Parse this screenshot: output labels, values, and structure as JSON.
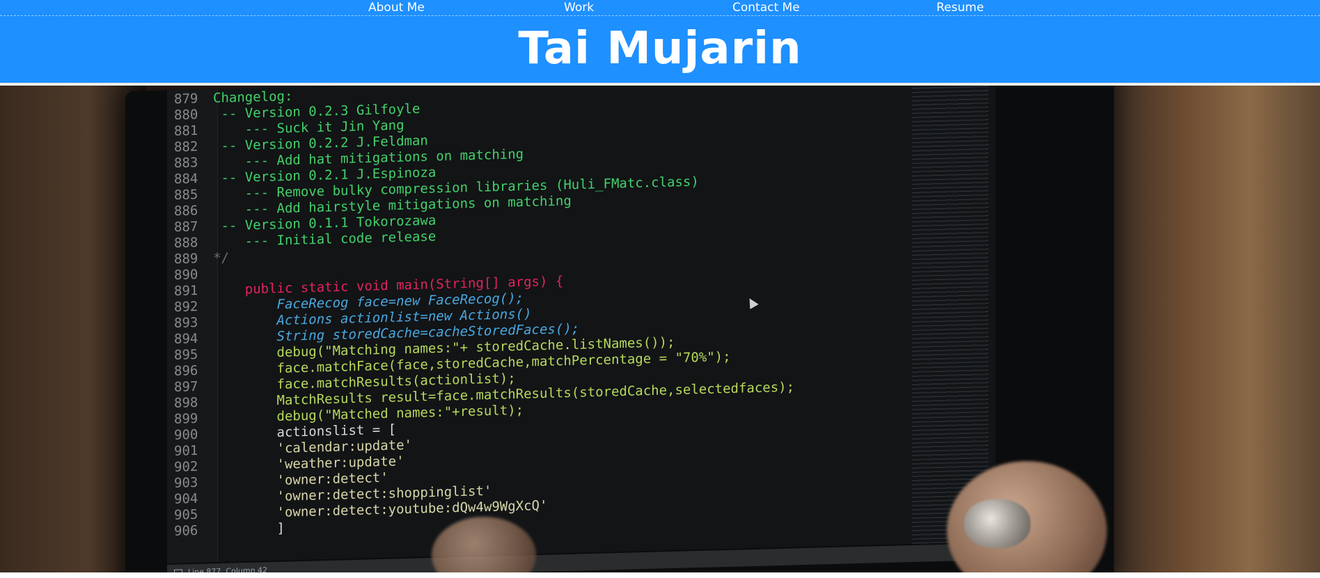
{
  "nav": {
    "items": [
      {
        "label": "About Me"
      },
      {
        "label": "Work"
      },
      {
        "label": "Contact Me"
      },
      {
        "label": "Resume"
      }
    ]
  },
  "header": {
    "title": "Tai Mujarin"
  },
  "hero": {
    "code_lines": [
      {
        "ln": "879",
        "text": "Changelog:"
      },
      {
        "ln": "880",
        "text": " -- Version 0.2.3 Gilfoyle"
      },
      {
        "ln": "881",
        "text": "    --- Suck it Jin Yang"
      },
      {
        "ln": "882",
        "text": " -- Version 0.2.2 J.Feldman"
      },
      {
        "ln": "883",
        "text": "    --- Add hat mitigations on matching"
      },
      {
        "ln": "884",
        "text": " -- Version 0.2.1 J.Espinoza"
      },
      {
        "ln": "885",
        "text": "    --- Remove bulky compression libraries (Huli_FMatc.class)"
      },
      {
        "ln": "886",
        "text": "    --- Add hairstyle mitigations on matching"
      },
      {
        "ln": "887",
        "text": " -- Version 0.1.1 Tokorozawa"
      },
      {
        "ln": "888",
        "text": "    --- Initial code release"
      },
      {
        "ln": "889",
        "text": "*/"
      },
      {
        "ln": "890",
        "text": ""
      },
      {
        "ln": "891",
        "text": "    public static void main(String[] args) {"
      },
      {
        "ln": "892",
        "text": "        FaceRecog face=new FaceRecog();"
      },
      {
        "ln": "893",
        "text": "        Actions actionlist=new Actions()"
      },
      {
        "ln": "894",
        "text": "        String storedCache=cacheStoredFaces();"
      },
      {
        "ln": "895",
        "text": "        debug(\"Matching names:\"+ storedCache.listNames());"
      },
      {
        "ln": "896",
        "text": "        face.matchFace(face,storedCache,matchPercentage = \"70%\");"
      },
      {
        "ln": "897",
        "text": "        face.matchResults(actionlist);"
      },
      {
        "ln": "898",
        "text": "        MatchResults result=face.matchResults(storedCache,selectedfaces);"
      },
      {
        "ln": "899",
        "text": "        debug(\"Matched names:\"+result);"
      },
      {
        "ln": "900",
        "text": "        actionslist = ["
      },
      {
        "ln": "901",
        "text": "        'calendar:update'"
      },
      {
        "ln": "902",
        "text": "        'weather:update'"
      },
      {
        "ln": "903",
        "text": "        'owner:detect'"
      },
      {
        "ln": "904",
        "text": "        'owner:detect:shoppinglist'"
      },
      {
        "ln": "905",
        "text": "        'owner:detect:youtube:dQw4w9WgXcQ'"
      },
      {
        "ln": "906",
        "text": "        ]"
      }
    ],
    "status_text": "Line 877, Column 42"
  },
  "colors": {
    "header_bg": "#1e90ff",
    "code_green": "#43d16a",
    "keyword": "#e0245e",
    "type": "#4aa8e0"
  },
  "icons": {
    "cursor": "mouse-cursor-icon",
    "status": "window-icon"
  }
}
